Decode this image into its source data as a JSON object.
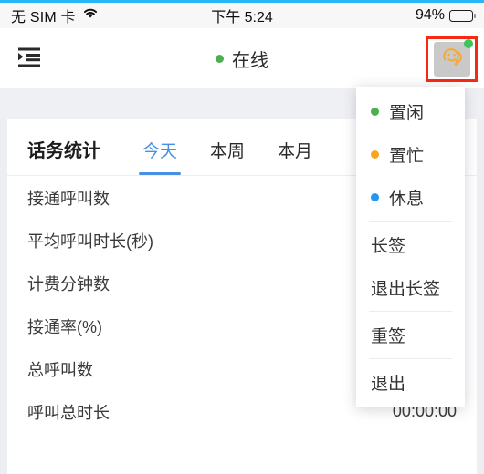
{
  "status_bar": {
    "carrier": "无 SIM 卡",
    "wifi_icon": "wifi-icon",
    "time": "下午 5:24",
    "battery_percent": "94%",
    "battery_level": 94
  },
  "nav_bar": {
    "menu_icon": "hamburger-indent-icon",
    "status_label": "在线",
    "status_color": "#4caf50",
    "avatar_icon": "agent-headset-avatar-icon",
    "avatar_badge_color": "#3fc35a",
    "highlight_color": "#f52a12"
  },
  "card": {
    "title": "话务统计",
    "tabs": [
      {
        "label": "今天",
        "active": true
      },
      {
        "label": "本周",
        "active": false
      },
      {
        "label": "本月",
        "active": false
      }
    ],
    "active_tab_color": "#4a90e2",
    "stats": [
      {
        "label": "接通呼叫数",
        "value": ""
      },
      {
        "label": "平均呼叫时长(秒)",
        "value": ""
      },
      {
        "label": "计费分钟数",
        "value": ""
      },
      {
        "label": "接通率(%)",
        "value": ""
      },
      {
        "label": "总呼叫数",
        "value": ""
      },
      {
        "label": "呼叫总时长",
        "value": "00:00:00"
      }
    ]
  },
  "dropdown": {
    "items": [
      {
        "label": "置闲",
        "dot": "dot-green",
        "divider_after": false
      },
      {
        "label": "置忙",
        "dot": "dot-orange",
        "divider_after": false
      },
      {
        "label": "休息",
        "dot": "dot-blue",
        "divider_after": true
      },
      {
        "label": "长签",
        "dot": "",
        "divider_after": false
      },
      {
        "label": "退出长签",
        "dot": "",
        "divider_after": true
      },
      {
        "label": "重签",
        "dot": "",
        "divider_after": true
      },
      {
        "label": "退出",
        "dot": "",
        "divider_after": false
      }
    ],
    "colors": {
      "idle": "#4caf50",
      "busy": "#f5a623",
      "rest": "#2196f3"
    }
  }
}
